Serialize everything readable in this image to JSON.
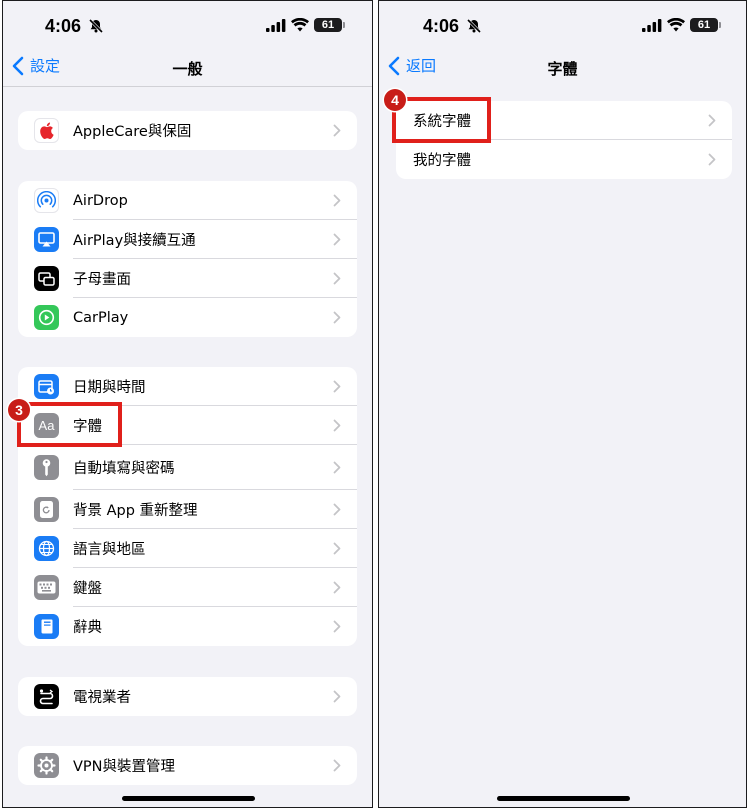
{
  "left_panel": {
    "status": {
      "time": "4:06",
      "battery": "61"
    },
    "nav": {
      "back_label": "設定",
      "title": "一般"
    },
    "groups": [
      {
        "items": [
          {
            "label": "AppleCare與保固",
            "icon": "apple-icon",
            "color": "#ffffff"
          }
        ]
      },
      {
        "items": [
          {
            "label": "AirDrop",
            "icon": "airdrop-icon",
            "color": "#ffffff"
          },
          {
            "label": "AirPlay與接續互通",
            "icon": "airplay-icon",
            "color": "#1a7cf5"
          },
          {
            "label": "子母畫面",
            "icon": "pip-icon",
            "color": "#000000"
          },
          {
            "label": "CarPlay",
            "icon": "carplay-icon",
            "color": "#34c759"
          }
        ]
      },
      {
        "items": [
          {
            "label": "日期與時間",
            "icon": "calendar-clock-icon",
            "color": "#1a7cf5"
          },
          {
            "label": "字體",
            "icon": "font-icon",
            "color": "#8e8e93"
          },
          {
            "label": "自動填寫與密碼",
            "icon": "key-icon",
            "color": "#8e8e93"
          },
          {
            "label": "背景 App 重新整理",
            "icon": "refresh-icon",
            "color": "#8e8e93"
          },
          {
            "label": "語言與地區",
            "icon": "globe-icon",
            "color": "#1a7cf5"
          },
          {
            "label": "鍵盤",
            "icon": "keyboard-icon",
            "color": "#8e8e93"
          },
          {
            "label": "辭典",
            "icon": "dictionary-icon",
            "color": "#1a7cf5"
          }
        ]
      },
      {
        "items": [
          {
            "label": "電視業者",
            "icon": "tv-provider-icon",
            "color": "#000000"
          }
        ]
      },
      {
        "items": [
          {
            "label": "VPN與裝置管理",
            "icon": "gear-icon",
            "color": "#8e8e93"
          }
        ]
      }
    ],
    "step_badge": "3"
  },
  "right_panel": {
    "status": {
      "time": "4:06",
      "battery": "61"
    },
    "nav": {
      "back_label": "返回",
      "title": "字體"
    },
    "items": [
      {
        "label": "系統字體"
      },
      {
        "label": "我的字體"
      }
    ],
    "step_badge": "4"
  },
  "colors": {
    "accent": "#0a7aff",
    "highlight": "#e0201b",
    "badge": "#c81d18",
    "background": "#f2f2f7"
  }
}
